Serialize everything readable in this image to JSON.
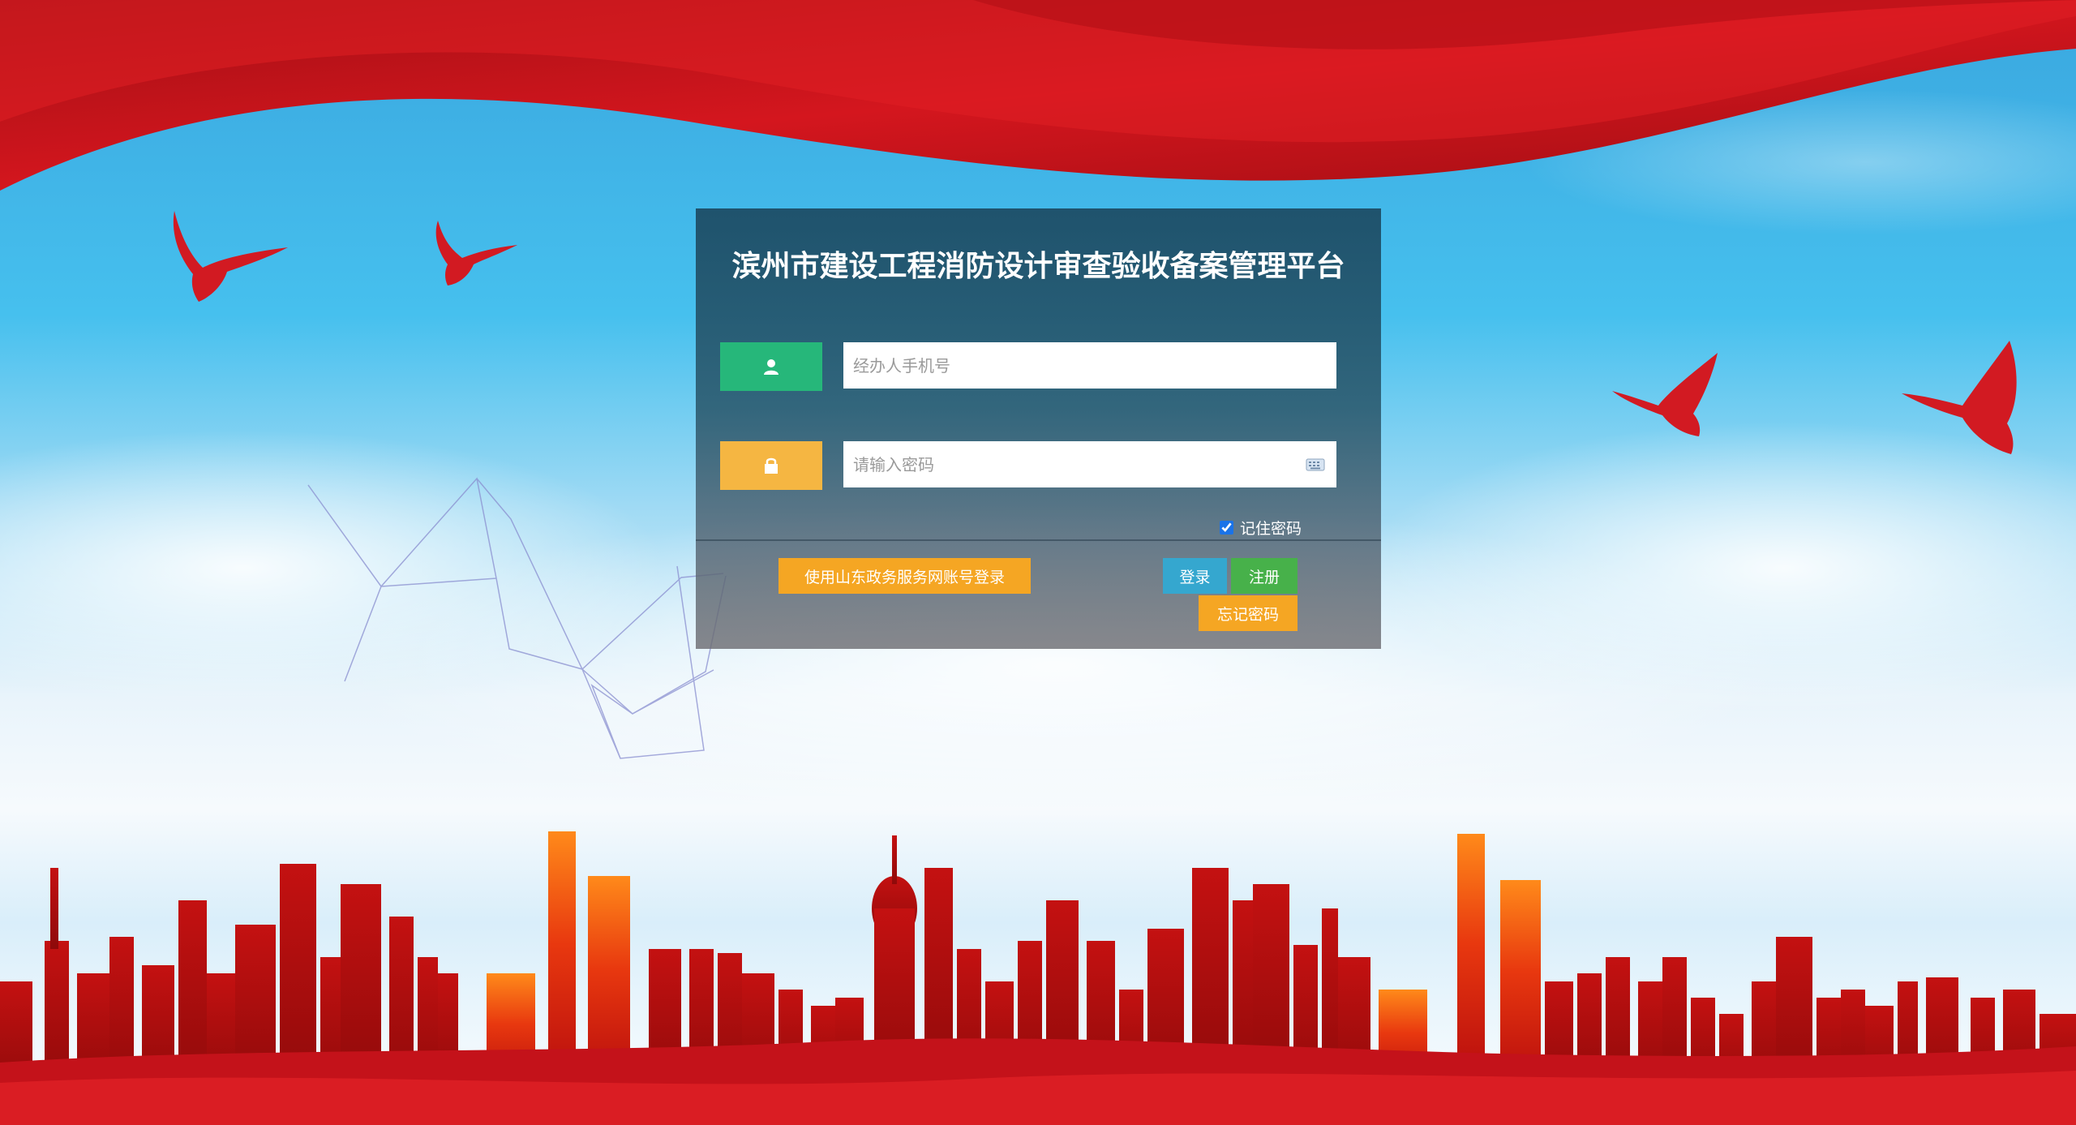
{
  "page": {
    "title": "滨州市建设工程消防设计审查验收备案管理平台"
  },
  "login_form": {
    "phone_placeholder": "经办人手机号",
    "phone_value": "",
    "password_placeholder": "请输入密码",
    "password_value": "",
    "remember_label": "记住密码",
    "remember_checked": true,
    "sd_login_label": "使用山东政务服务网账号登录",
    "login_label": "登录",
    "register_label": "注册",
    "forgot_label": "忘记密码"
  },
  "icons": {
    "phone_field": "user-icon",
    "password_field": "lock-icon",
    "password_keyboard": "keyboard-icon"
  },
  "colors": {
    "user_icon_bg": "#26b77a",
    "lock_icon_bg": "#f5b642",
    "sd_login_bg": "#f5a623",
    "login_bg": "#35a7cf",
    "register_bg": "#47b14a",
    "forgot_bg": "#f5a623",
    "banner_red": "#c8141c"
  }
}
